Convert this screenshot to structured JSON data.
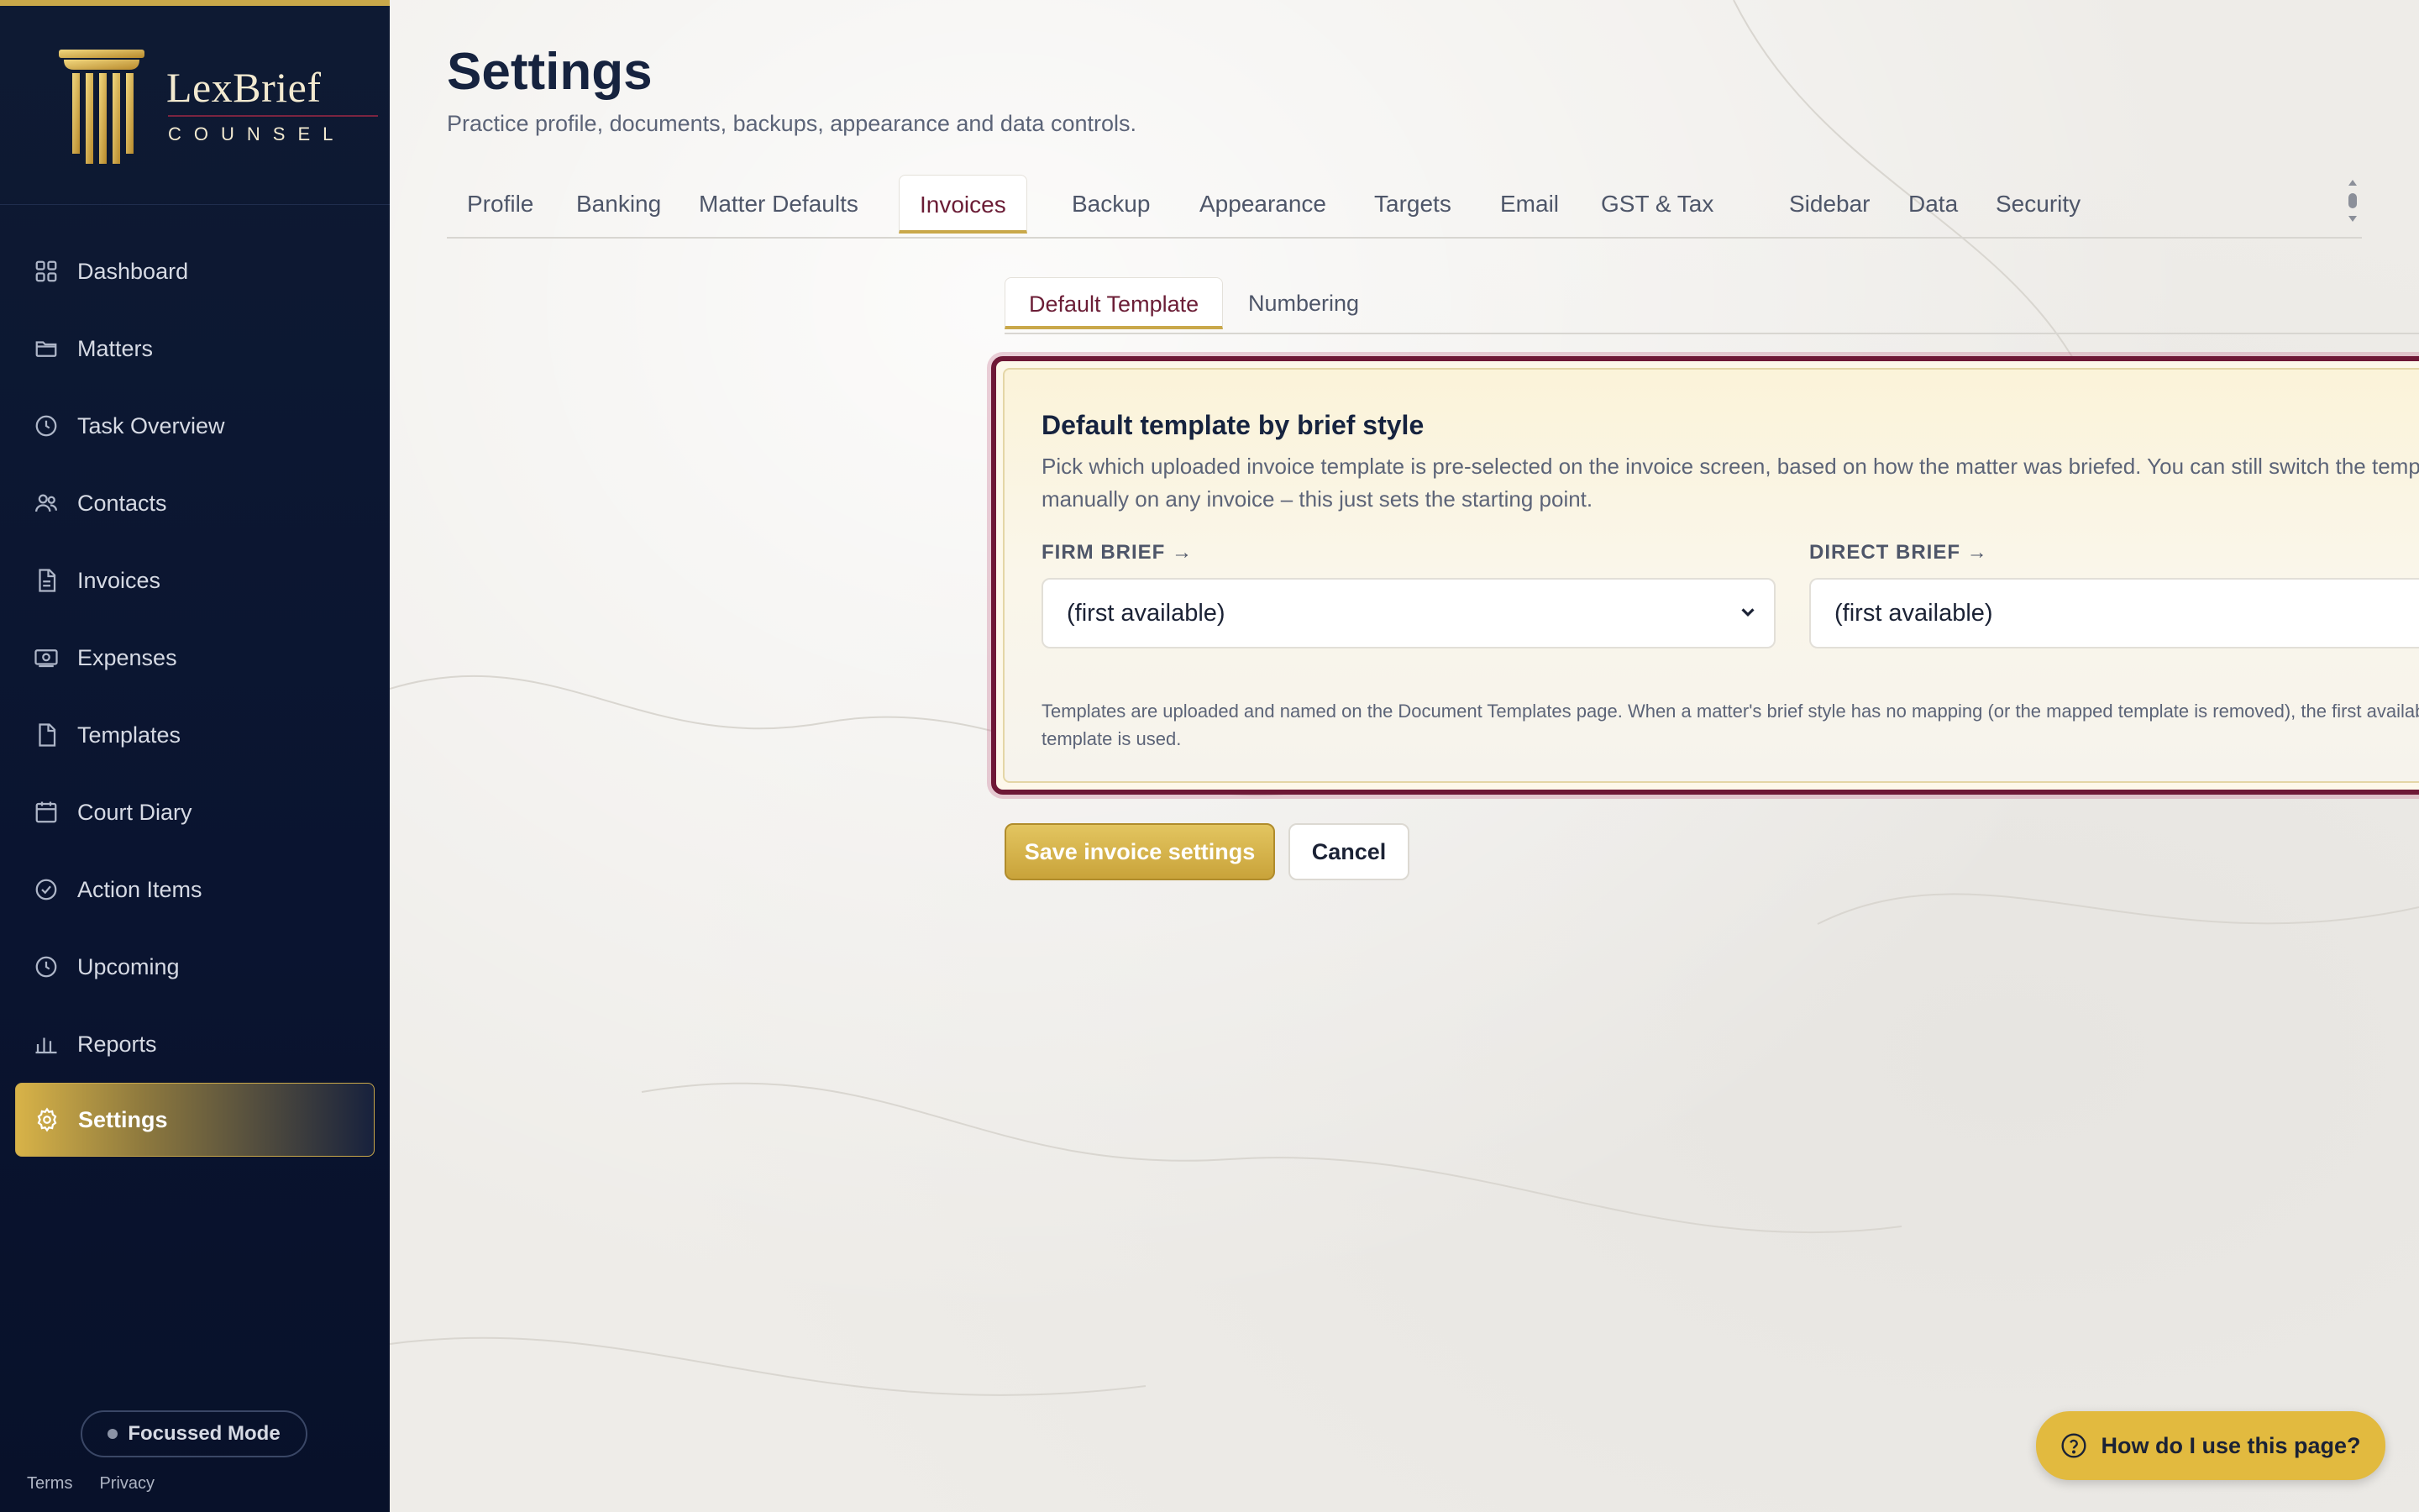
{
  "brand": {
    "name": "LexBrief",
    "tagline": "COUNSEL"
  },
  "sidebar": {
    "items": [
      {
        "label": "Dashboard",
        "icon": "grid-icon"
      },
      {
        "label": "Matters",
        "icon": "folder-icon"
      },
      {
        "label": "Task Overview",
        "icon": "clock-icon"
      },
      {
        "label": "Contacts",
        "icon": "users-icon"
      },
      {
        "label": "Invoices",
        "icon": "file-text-icon"
      },
      {
        "label": "Expenses",
        "icon": "banknote-icon"
      },
      {
        "label": "Templates",
        "icon": "file-icon"
      },
      {
        "label": "Court Diary",
        "icon": "calendar-icon"
      },
      {
        "label": "Action Items",
        "icon": "check-circle-icon"
      },
      {
        "label": "Upcoming",
        "icon": "clock-icon"
      },
      {
        "label": "Reports",
        "icon": "bar-chart-icon"
      },
      {
        "label": "Settings",
        "icon": "gear-icon",
        "active": true
      }
    ],
    "focus_mode_label": "Focussed Mode",
    "footer_links": [
      "Terms",
      "Privacy"
    ]
  },
  "header": {
    "title": "Settings",
    "subtitle": "Practice profile, documents, backups, appearance and data controls."
  },
  "tabs": [
    "Profile",
    "Banking",
    "Matter Defaults",
    "Invoices",
    "Backup",
    "Appearance",
    "Targets",
    "Email",
    "GST & Tax",
    "Sidebar",
    "Data",
    "Security"
  ],
  "active_tab": "Invoices",
  "subtabs": [
    "Default Template",
    "Numbering"
  ],
  "active_subtab": "Default Template",
  "card": {
    "title": "Default template by brief style",
    "description": "Pick which uploaded invoice template is pre-selected on the invoice screen, based on how the matter was briefed. You can still switch the template manually on any invoice – this just sets the starting point.",
    "firm_label": "FIRM BRIEF →",
    "firm_value": "(first available)",
    "direct_label": "DIRECT BRIEF →",
    "direct_value": "(first available)",
    "note": "Templates are uploaded and named on the Document Templates page. When a matter's brief style has no mapping (or the mapped template is removed), the first available invoice template is used."
  },
  "actions": {
    "save_label": "Save invoice settings",
    "cancel_label": "Cancel"
  },
  "help_label": "How do I use this page?",
  "colors": {
    "navy": "#0e1a33",
    "gold": "#c9a84a",
    "burgundy": "#6e1836"
  }
}
